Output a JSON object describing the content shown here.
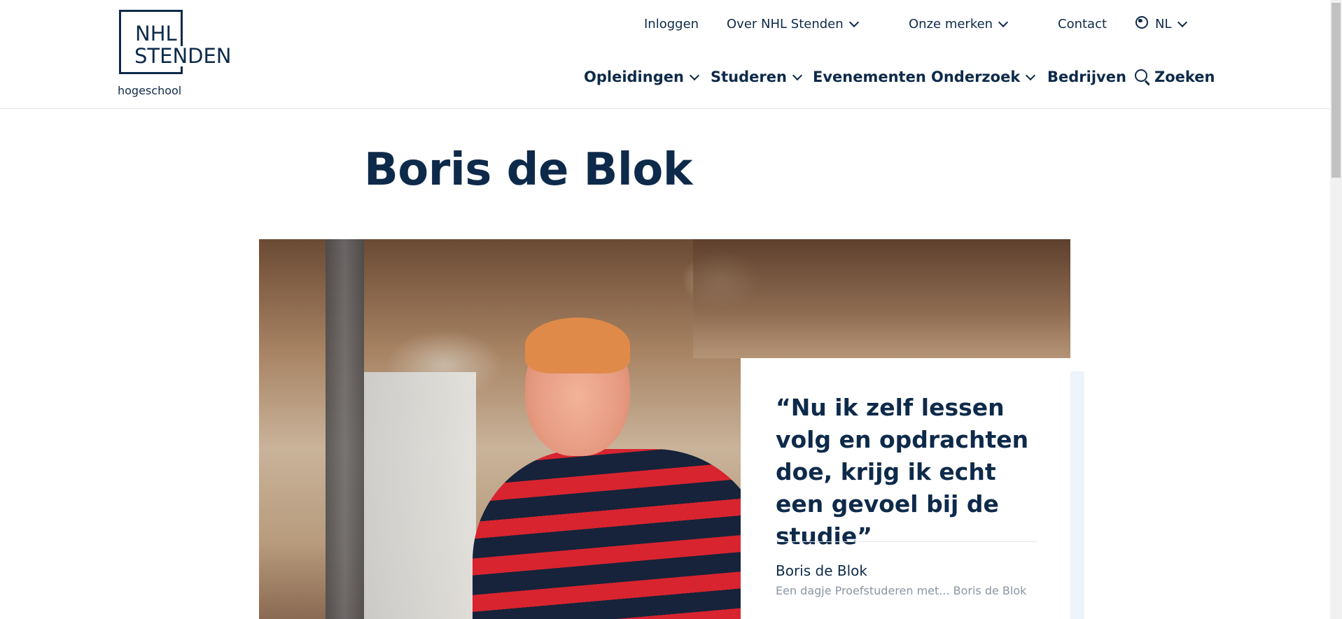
{
  "logo": {
    "line1": "NHL",
    "line2": "STENDEN",
    "subtitle": "hogeschool"
  },
  "topnav": {
    "login": "Inloggen",
    "about": "Over NHL Stenden",
    "brands": "Onze merken",
    "contact": "Contact",
    "language": "NL"
  },
  "mainnav": {
    "programs": "Opleidingen",
    "study": "Studeren",
    "events": "Evenementen",
    "research": "Onderzoek",
    "companies": "Bedrijven",
    "search": "Zoeken"
  },
  "page": {
    "title": "Boris de Blok"
  },
  "quote": {
    "text": "“Nu ik zelf lessen volg en opdrachten doe, krijg ik echt een gevoel bij de studie”",
    "name": "Boris de Blok",
    "subtitle": "Een dagje Proefstuderen met... Boris de Blok"
  },
  "colors": {
    "brand_navy": "#0e2a4a",
    "accent_light": "#eef4fb"
  },
  "icons": [
    "chevron-down-icon",
    "globe-icon",
    "search-icon"
  ]
}
